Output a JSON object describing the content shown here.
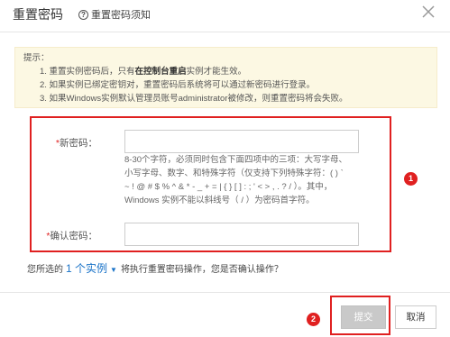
{
  "dialog": {
    "title": "重置密码",
    "help_link": "重置密码须知",
    "close_icon": "close-icon"
  },
  "tips": {
    "title": "提示：",
    "lines": [
      "1. 重置实例密码后，只有",
      "在控制台重启",
      "实例才能生效。",
      "2. 如果实例已绑定密钥对，重置密码后系统将可以通过新密码进行登录。",
      "3. 如果Windows实例默认管理员账号administrator被修改，则重置密码将会失败。"
    ]
  },
  "form": {
    "new_password_label": "新密码：",
    "new_password_value": "",
    "confirm_password_label": "确认密码：",
    "confirm_password_value": "",
    "required_mark": "*",
    "hint_lines": [
      "8-30个字符，必须同时包含下面四项中的三项：大写字母、",
      "小写字母、数字、和特殊字符（仅支持下列特殊字符：( ) `",
      "~ ! @ # $ % ^ & * - _ + = | { } [ ] : ; ' < > , . ? / ）。其中，",
      "Windows 实例不能以斜线号（ / ）为密码首字符。"
    ]
  },
  "confirm": {
    "prefix": "您所选的",
    "instance_link": "1 个实例",
    "suffix": "将执行重置密码操作，您是否确认操作？"
  },
  "badges": {
    "one": "1",
    "two": "2"
  },
  "footer": {
    "submit_label": "提交",
    "cancel_label": "取消"
  },
  "colors": {
    "accent_red": "#e02020",
    "link_blue": "#1a73c8",
    "tips_bg": "#fcf8e3"
  }
}
